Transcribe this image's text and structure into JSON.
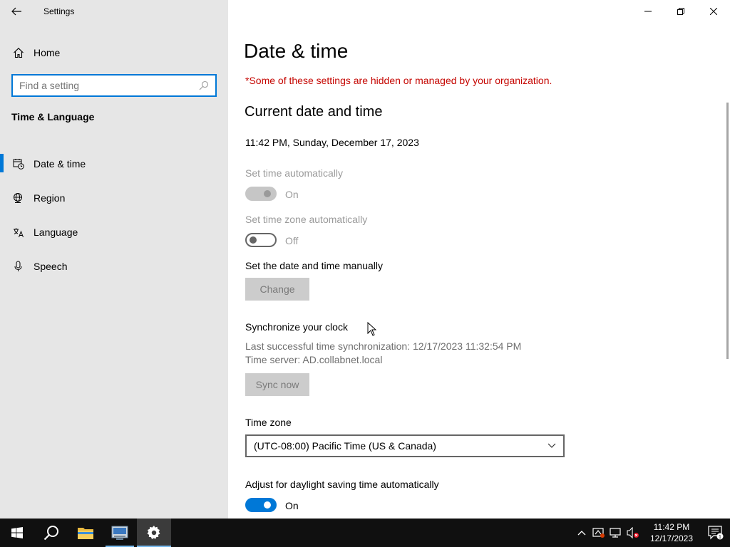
{
  "app": {
    "title": "Settings"
  },
  "sidebar": {
    "home_label": "Home",
    "search_placeholder": "Find a setting",
    "section": "Time & Language",
    "items": [
      {
        "label": "Date & time",
        "icon": "date-time-icon",
        "active": true
      },
      {
        "label": "Region",
        "icon": "globe-icon",
        "active": false
      },
      {
        "label": "Language",
        "icon": "language-icon",
        "active": false
      },
      {
        "label": "Speech",
        "icon": "microphone-icon",
        "active": false
      }
    ]
  },
  "main": {
    "title": "Date & time",
    "org_note": "*Some of these settings are hidden or managed by your organization.",
    "current_title": "Current date and time",
    "current_datetime": "11:42 PM, Sunday, December 17, 2023",
    "set_time_auto": {
      "label": "Set time automatically",
      "state": "On",
      "enabled": false
    },
    "set_tz_auto": {
      "label": "Set time zone automatically",
      "state": "Off",
      "enabled": false
    },
    "manual": {
      "label": "Set the date and time manually",
      "button": "Change"
    },
    "sync": {
      "title": "Synchronize your clock",
      "last_sync": "Last successful time synchronization: 12/17/2023 11:32:54 PM",
      "server": "Time server: AD.collabnet.local",
      "button": "Sync now"
    },
    "timezone": {
      "label": "Time zone",
      "value": "(UTC-08:00) Pacific Time (US & Canada)"
    },
    "dst": {
      "label": "Adjust for daylight saving time automatically",
      "state": "On"
    }
  },
  "taskbar": {
    "time": "11:42 PM",
    "date": "12/17/2023",
    "notification_count": "1",
    "accent": "#0078d7"
  }
}
